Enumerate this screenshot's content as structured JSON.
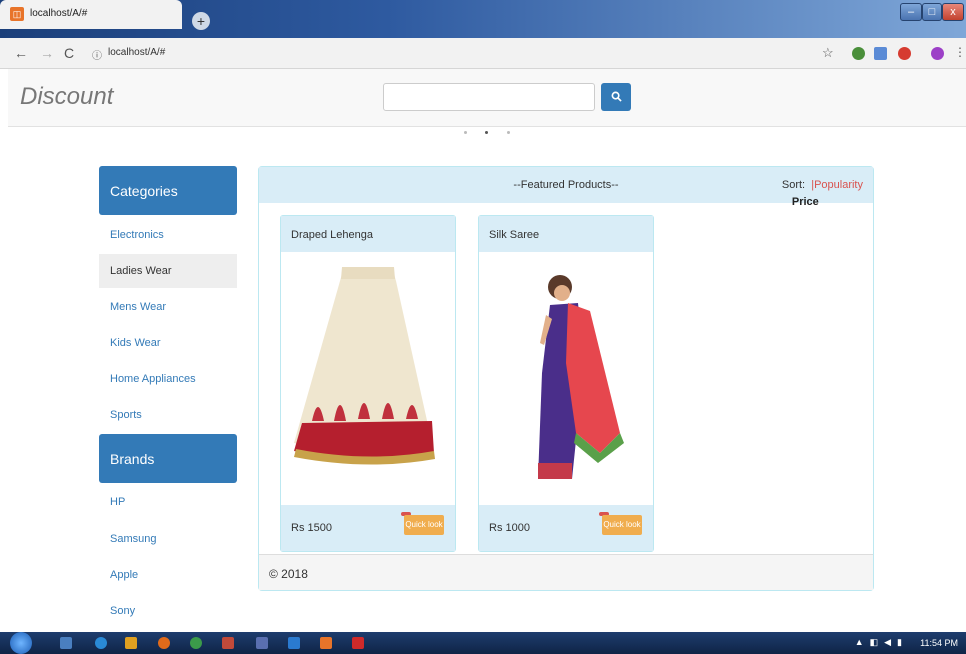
{
  "browser": {
    "tab_title": "localhost/A/#",
    "tab_close": "×",
    "new_tab": "+",
    "url": "localhost/A/#",
    "win_min": "–",
    "win_max": "□",
    "win_close": "x"
  },
  "header": {
    "brand": "Discount",
    "search_placeholder": ""
  },
  "sidebar": {
    "categories_title": "Categories",
    "categories": [
      {
        "label": "Electronics"
      },
      {
        "label": "Ladies Wear"
      },
      {
        "label": "Mens Wear"
      },
      {
        "label": "Kids Wear"
      },
      {
        "label": "Home Appliances"
      },
      {
        "label": "Sports"
      }
    ],
    "brands_title": "Brands",
    "brands": [
      {
        "label": "HP"
      },
      {
        "label": "Samsung"
      },
      {
        "label": "Apple"
      },
      {
        "label": "Sony"
      }
    ]
  },
  "panel": {
    "title": "--Featured Products--",
    "sort_label": "Sort:",
    "sort_price": "Price",
    "sort_sep": "|",
    "sort_popularity": "Popularity",
    "footer": "© 2018"
  },
  "products": [
    {
      "name": "Draped Lehenga",
      "price": "Rs 1500",
      "quick_look": "Quick look"
    },
    {
      "name": "Silk Saree",
      "price": "Rs 1000",
      "quick_look": "Quick look"
    }
  ],
  "taskbar": {
    "clock": "11:54 PM"
  },
  "colors": {
    "primary": "#337ab7",
    "panel_bg": "#d9edf7",
    "warning": "#f0ad4e",
    "danger": "#d9534f"
  }
}
